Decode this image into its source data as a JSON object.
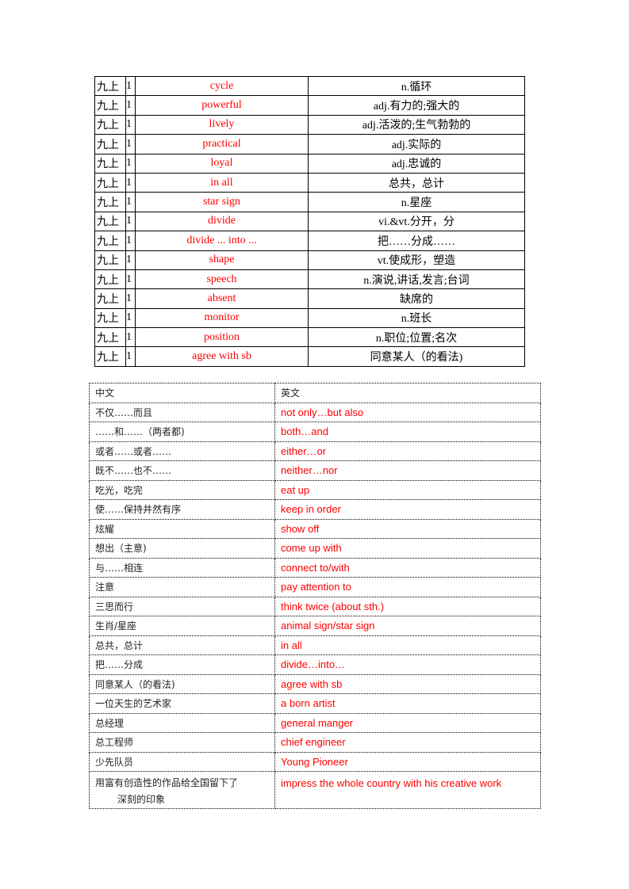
{
  "vocab_table": {
    "rows": [
      {
        "grade": "九上",
        "unit": "1",
        "en": "cycle",
        "cn": "n.循环"
      },
      {
        "grade": "九上",
        "unit": "1",
        "en": "powerful",
        "cn": "adj.有力的;强大的"
      },
      {
        "grade": "九上",
        "unit": "1",
        "en": "lively",
        "cn": "adj.活泼的;生气勃勃的"
      },
      {
        "grade": "九上",
        "unit": "1",
        "en": "practical",
        "cn": "adj.实际的"
      },
      {
        "grade": "九上",
        "unit": "1",
        "en": "loyal",
        "cn": "adj.忠诚的"
      },
      {
        "grade": "九上",
        "unit": "1",
        "en": "in all",
        "cn": "总共，总计"
      },
      {
        "grade": "九上",
        "unit": "1",
        "en": "star sign",
        "cn": "n.星座"
      },
      {
        "grade": "九上",
        "unit": "1",
        "en": "divide",
        "cn": "vi.&vt.分开，分"
      },
      {
        "grade": "九上",
        "unit": "1",
        "en": "divide ... into ...",
        "cn": "把……分成……"
      },
      {
        "grade": "九上",
        "unit": "1",
        "en": "shape",
        "cn": "vt.使成形，塑造"
      },
      {
        "grade": "九上",
        "unit": "1",
        "en": "speech",
        "cn": "n.演说,讲话,发言;台词"
      },
      {
        "grade": "九上",
        "unit": "1",
        "en": "absent",
        "cn": "缺席的"
      },
      {
        "grade": "九上",
        "unit": "1",
        "en": "monitor",
        "cn": "n.班长"
      },
      {
        "grade": "九上",
        "unit": "1",
        "en": "position",
        "cn": "n.职位;位置;名次"
      },
      {
        "grade": "九上",
        "unit": "1",
        "en": "agree with sb",
        "cn": "同意某人（的看法)"
      }
    ]
  },
  "phrase_table": {
    "header": {
      "cn": "中文",
      "en": "英文"
    },
    "rows": [
      {
        "cn": "不仅……而且",
        "en": "not only…but also"
      },
      {
        "cn": "……和……（两者都)",
        "en": "both…and"
      },
      {
        "cn": "或者……或者……",
        "en": "either…or"
      },
      {
        "cn": "既不……也不……",
        "en": "neither…nor"
      },
      {
        "cn": "吃光，吃完",
        "en": "eat up"
      },
      {
        "cn": "使……保持井然有序",
        "en": "keep in order"
      },
      {
        "cn": "炫耀",
        "en": "show off"
      },
      {
        "cn": "想出（主意)",
        "en": "come up with"
      },
      {
        "cn": "与……相连",
        "en": "connect to/with"
      },
      {
        "cn": "注意",
        "en": "pay attention to"
      },
      {
        "cn": "三思而行",
        "en": "think twice (about sth.)"
      },
      {
        "cn": "生肖/星座",
        "en": "animal sign/star sign"
      },
      {
        "cn": "总共，总计",
        "en": "in all"
      },
      {
        "cn": "把……分成",
        "en": "divide…into…"
      },
      {
        "cn": "同意某人（的看法)",
        "en": "agree with sb"
      },
      {
        "cn": "一位天生的艺术家",
        "en": "a born artist"
      },
      {
        "cn": "总经理",
        "en": "general manger"
      },
      {
        "cn": "总工程师",
        "en": "chief engineer"
      },
      {
        "cn": "少先队员",
        "en": "Young Pioneer"
      }
    ],
    "last_row": {
      "cn_line1": "用富有创造性的作品给全国留下了",
      "cn_line2": "深刻的印象",
      "en": "impress the whole country with his creative work"
    }
  },
  "colors": {
    "english_text": "#ff0000",
    "border": "#000000"
  }
}
